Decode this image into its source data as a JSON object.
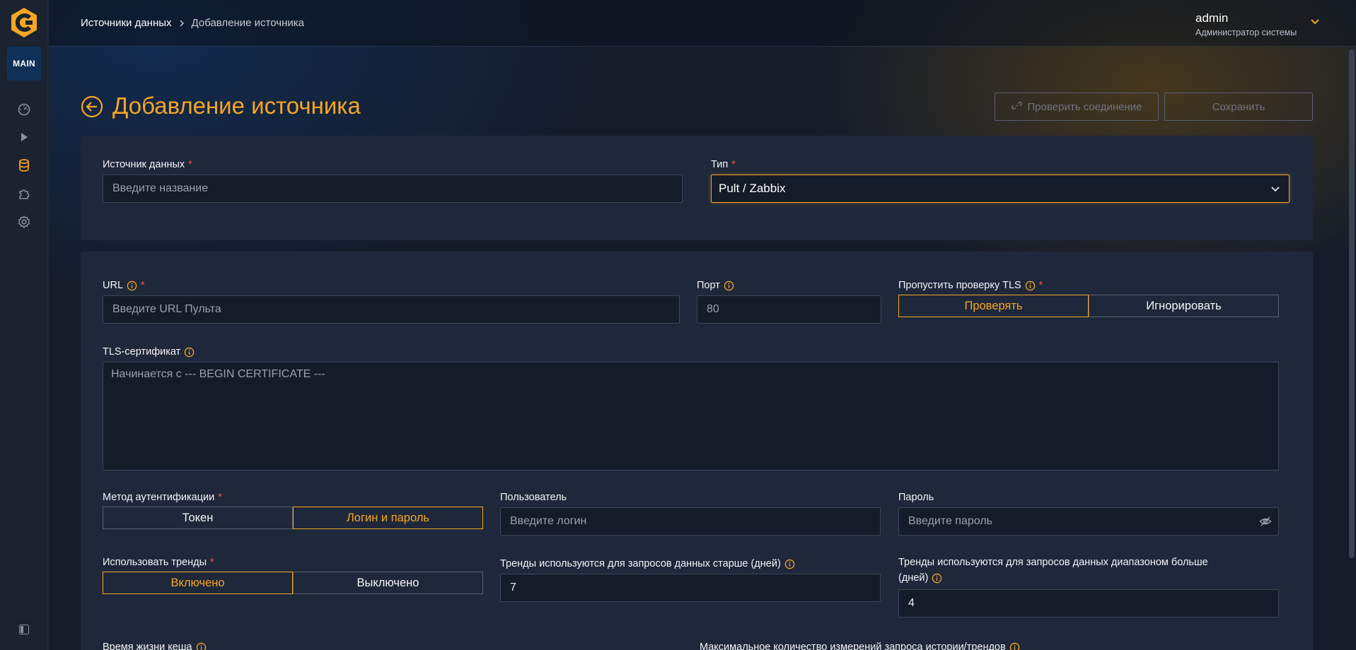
{
  "sidebar": {
    "main_label": "MAIN",
    "items": [
      {
        "icon": "dashboard-icon"
      },
      {
        "icon": "play-icon"
      },
      {
        "icon": "database-icon",
        "active": true
      },
      {
        "icon": "puzzle-icon"
      },
      {
        "icon": "gear-icon"
      }
    ]
  },
  "header": {
    "breadcrumb": {
      "link": "Источники данных",
      "current": "Добавление источника"
    },
    "user": {
      "name": "admin",
      "role": "Администратор системы"
    }
  },
  "page": {
    "title": "Добавление источника",
    "check_connection_label": "Проверить соединение",
    "save_label": "Сохранить"
  },
  "form": {
    "source": {
      "label": "Источник данных",
      "required_mark": "*",
      "placeholder": "Введите название"
    },
    "type": {
      "label": "Тип",
      "required_mark": "*",
      "value": "Pult / Zabbix"
    },
    "url": {
      "label": "URL",
      "required_mark": "*",
      "placeholder": "Введите URL Пульта"
    },
    "port": {
      "label": "Порт",
      "value": "80"
    },
    "tls_skip": {
      "label": "Пропустить проверку TLS",
      "required_mark": "*",
      "options": [
        "Проверять",
        "Игнорировать"
      ],
      "selected": "Проверять"
    },
    "tls_cert": {
      "label": "TLS-сертификат",
      "placeholder": "Начинается с --- BEGIN CERTIFICATE ---"
    },
    "auth": {
      "label": "Метод аутентификации",
      "required_mark": "*",
      "options": [
        "Токен",
        "Логин и пароль"
      ],
      "selected": "Логин и пароль"
    },
    "user": {
      "label": "Пользователь",
      "placeholder": "Введите логин"
    },
    "password": {
      "label": "Пароль",
      "placeholder": "Введите пароль"
    },
    "trends": {
      "label": "Использовать тренды",
      "required_mark": "*",
      "options": [
        "Включено",
        "Выключено"
      ],
      "selected": "Включено"
    },
    "trends_older": {
      "label": "Тренды используются для запросов данных старше (дней)",
      "value": "7"
    },
    "trends_range": {
      "label_line1": "Тренды используются для запросов данных диапазоном больше",
      "label_line2": "(дней)",
      "value": "4"
    },
    "cache_ttl": {
      "label": "Время жизни кеша"
    },
    "max_metrics": {
      "label": "Максимальное количество измерений запроса истории/трендов"
    }
  },
  "colors": {
    "accent": "#f5a623",
    "required": "#ff4d4f",
    "card": "#1f283a",
    "input_bg": "#141c29"
  }
}
